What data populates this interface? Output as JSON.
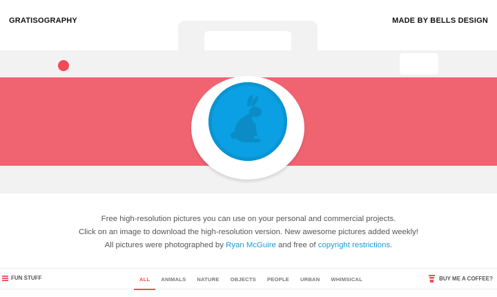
{
  "header": {
    "logo": "GRATISOGRAPHY",
    "credit": "MADE BY BELLS DESIGN"
  },
  "intro": {
    "line1": "Free high-resolution pictures you can use on your personal and commercial projects.",
    "line2": "Click on an image to download the high-resolution version. New awesome pictures added weekly!",
    "line3_prefix": "All pictures were photographed by ",
    "line3_link1": "Ryan McGuire",
    "line3_mid": " and free of ",
    "line3_link2": "copyright restrictions",
    "line3_suffix": "."
  },
  "nav": {
    "left_label": "FUN STUFF",
    "right_label": "BUY ME A COFFEE?",
    "categories": [
      {
        "label": "ALL",
        "active": true
      },
      {
        "label": "ANIMALS",
        "active": false
      },
      {
        "label": "NATURE",
        "active": false
      },
      {
        "label": "OBJECTS",
        "active": false
      },
      {
        "label": "PEOPLE",
        "active": false
      },
      {
        "label": "URBAN",
        "active": false
      },
      {
        "label": "WHIMSICAL",
        "active": false
      }
    ]
  },
  "colors": {
    "accent": "#f24a55",
    "stripe": "#f06472",
    "lens": "#0aa0e3",
    "link": "#1c9ad6"
  },
  "icons": {
    "lens": "bunny-icon",
    "nav_left": "menu-icon",
    "nav_right": "coffee-cup-icon"
  }
}
